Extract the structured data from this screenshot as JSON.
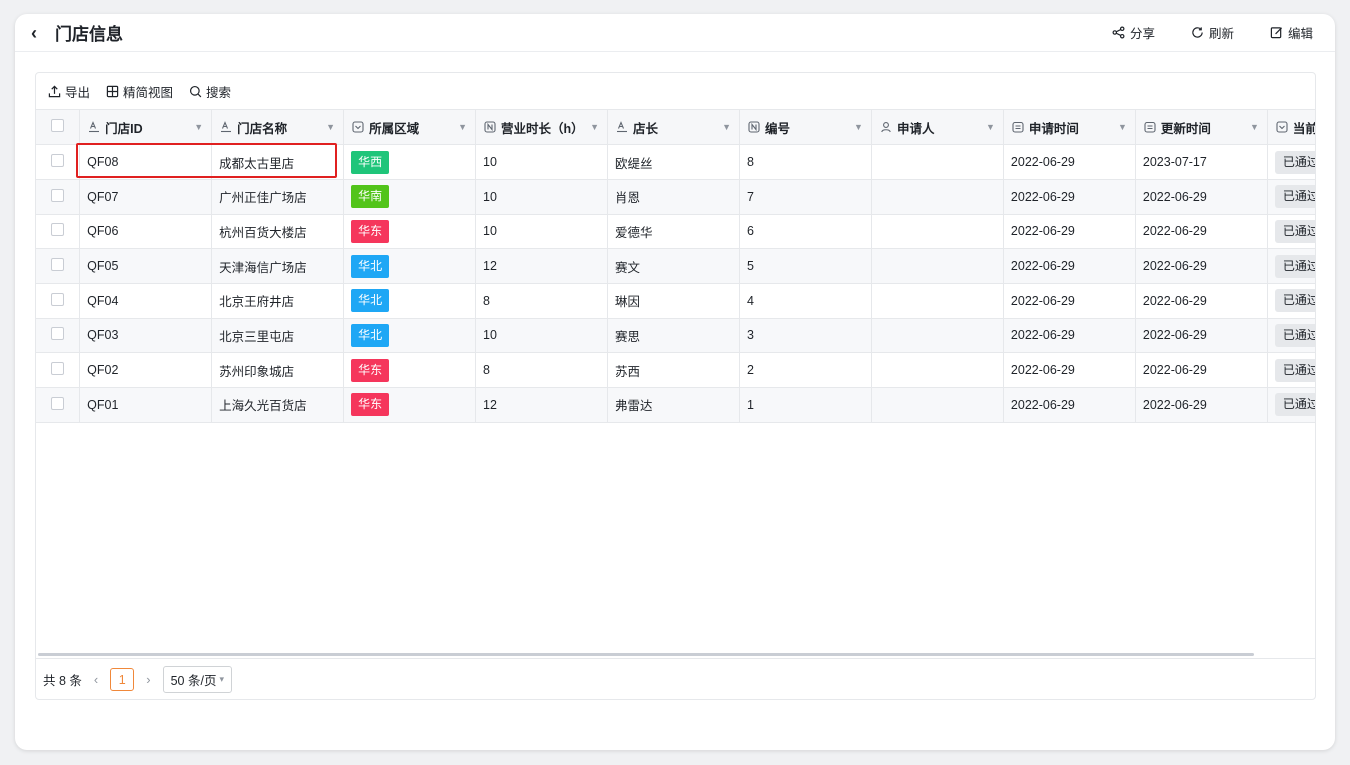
{
  "header": {
    "back_label": "‹",
    "title": "门店信息",
    "actions": [
      {
        "label": "分享",
        "icon": "share-icon"
      },
      {
        "label": "刷新",
        "icon": "refresh-icon"
      },
      {
        "label": "编辑",
        "icon": "edit-icon"
      }
    ]
  },
  "toolbar": {
    "export_label": "导出",
    "view_label": "精简视图",
    "search_label": "搜索"
  },
  "table": {
    "columns": [
      {
        "label": "门店ID",
        "icon": "text-field-icon"
      },
      {
        "label": "门店名称",
        "icon": "text-field-icon"
      },
      {
        "label": "所属区域",
        "icon": "select-field-icon"
      },
      {
        "label": "营业时长（h）",
        "icon": "number-field-icon"
      },
      {
        "label": "店长",
        "icon": "text-field-icon"
      },
      {
        "label": "编号",
        "icon": "number-field-icon"
      },
      {
        "label": "申请人",
        "icon": "person-field-icon"
      },
      {
        "label": "申请时间",
        "icon": "date-field-icon"
      },
      {
        "label": "更新时间",
        "icon": "date-field-icon"
      },
      {
        "label": "当前流",
        "icon": "select-field-icon"
      }
    ],
    "rows": [
      {
        "id": "QF08",
        "name": "成都太古里店",
        "region": "华西",
        "region_color": "#1fc57a",
        "hours": "10",
        "manager": "欧缇丝",
        "no": "8",
        "applicant": "",
        "apply_date": "2022-06-29",
        "update_date": "2023-07-17",
        "status": "已通过"
      },
      {
        "id": "QF07",
        "name": "广州正佳广场店",
        "region": "华南",
        "region_color": "#52c41a",
        "hours": "10",
        "manager": "肖恩",
        "no": "7",
        "applicant": "",
        "apply_date": "2022-06-29",
        "update_date": "2022-06-29",
        "status": "已通过"
      },
      {
        "id": "QF06",
        "name": "杭州百货大楼店",
        "region": "华东",
        "region_color": "#f5365c",
        "hours": "10",
        "manager": "爱德华",
        "no": "6",
        "applicant": "",
        "apply_date": "2022-06-29",
        "update_date": "2022-06-29",
        "status": "已通过"
      },
      {
        "id": "QF05",
        "name": "天津海信广场店",
        "region": "华北",
        "region_color": "#1ea7f5",
        "hours": "12",
        "manager": "赛文",
        "no": "5",
        "applicant": "",
        "apply_date": "2022-06-29",
        "update_date": "2022-06-29",
        "status": "已通过"
      },
      {
        "id": "QF04",
        "name": "北京王府井店",
        "region": "华北",
        "region_color": "#1ea7f5",
        "hours": "8",
        "manager": "琳因",
        "no": "4",
        "applicant": "",
        "apply_date": "2022-06-29",
        "update_date": "2022-06-29",
        "status": "已通过"
      },
      {
        "id": "QF03",
        "name": "北京三里屯店",
        "region": "华北",
        "region_color": "#1ea7f5",
        "hours": "10",
        "manager": "赛思",
        "no": "3",
        "applicant": "",
        "apply_date": "2022-06-29",
        "update_date": "2022-06-29",
        "status": "已通过"
      },
      {
        "id": "QF02",
        "name": "苏州印象城店",
        "region": "华东",
        "region_color": "#f5365c",
        "hours": "8",
        "manager": "苏西",
        "no": "2",
        "applicant": "",
        "apply_date": "2022-06-29",
        "update_date": "2022-06-29",
        "status": "已通过"
      },
      {
        "id": "QF01",
        "name": "上海久光百货店",
        "region": "华东",
        "region_color": "#f5365c",
        "hours": "12",
        "manager": "弗雷达",
        "no": "1",
        "applicant": "",
        "apply_date": "2022-06-29",
        "update_date": "2022-06-29",
        "status": "已通过"
      }
    ]
  },
  "pagination": {
    "total_label": "共 8 条",
    "current_page": "1",
    "prev": "‹",
    "next": "›",
    "page_size_label": "50 条/页"
  }
}
